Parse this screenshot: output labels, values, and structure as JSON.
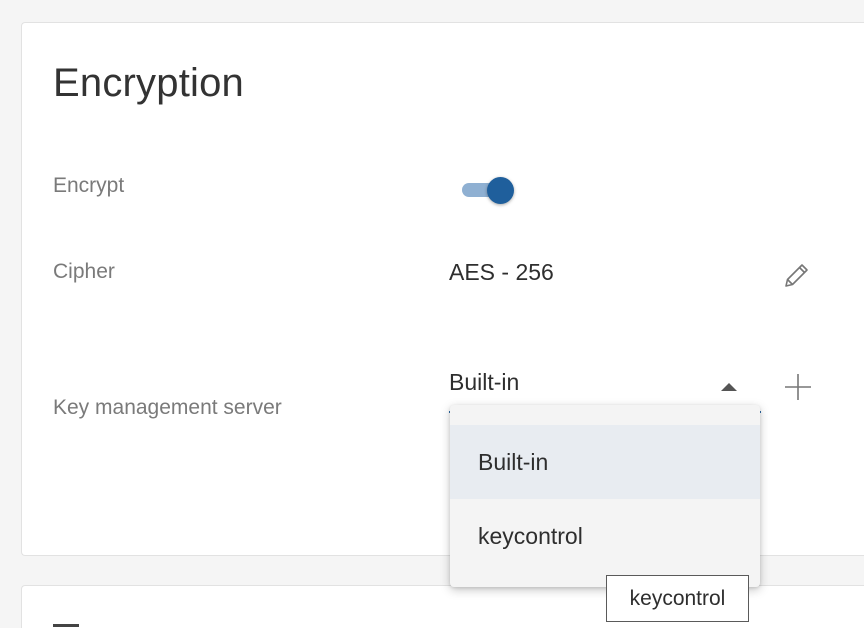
{
  "section": {
    "title": "Encryption"
  },
  "encrypt": {
    "label": "Encrypt",
    "enabled": true
  },
  "cipher": {
    "label": "Cipher",
    "value": "AES - 256",
    "edit_icon": "pencil-icon"
  },
  "kms": {
    "label": "Key management server",
    "selected": "Built-in",
    "caret_icon": "caret-up-icon",
    "add_icon": "plus-icon",
    "options": [
      "Built-in",
      "keycontrol"
    ]
  },
  "tooltip": {
    "text": "keycontrol"
  },
  "colors": {
    "accent": "#1f5f9c",
    "toggle_track": "#8fb0d2",
    "selected_option_bg": "#e8ecf1"
  }
}
